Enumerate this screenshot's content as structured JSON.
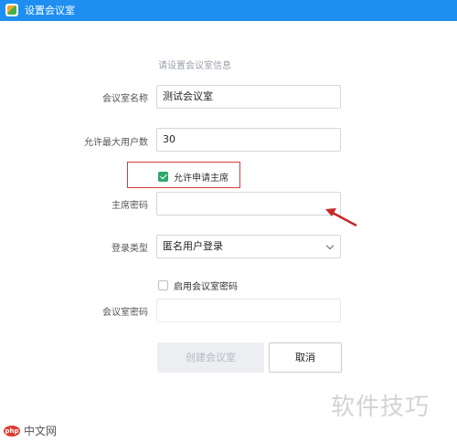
{
  "window": {
    "title": "设置会议室"
  },
  "form": {
    "subtitle": "请设置会议室信息",
    "room_name": {
      "label": "会议室名称",
      "value": "测试会议室"
    },
    "max_users": {
      "label": "允许最大用户数",
      "value": "30"
    },
    "allow_host_apply": {
      "label": "允许申请主席",
      "checked": true
    },
    "host_password": {
      "label": "主席密码",
      "value": ""
    },
    "login_type": {
      "label": "登录类型",
      "value": "匿名用户登录"
    },
    "enable_room_password": {
      "label": "启用会议室密码",
      "checked": false
    },
    "room_password": {
      "label": "会议室密码",
      "value": ""
    }
  },
  "buttons": {
    "create": "创建会议室",
    "cancel": "取消"
  },
  "watermarks": {
    "right": "软件技巧",
    "left_text": "中文网",
    "left_badge": "php"
  },
  "colors": {
    "titlebar": "#1e8ff0",
    "highlight": "#d93a3a",
    "check": "#2fa86b"
  }
}
